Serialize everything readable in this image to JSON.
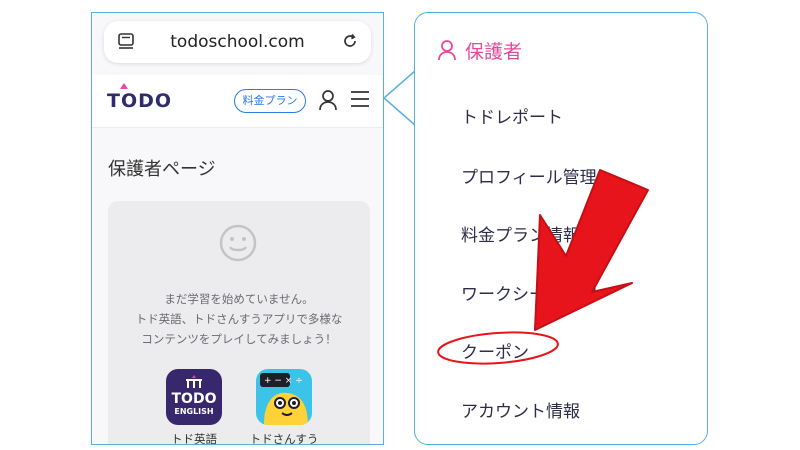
{
  "browser": {
    "url": "todoschool.com"
  },
  "header": {
    "logo": "TODO",
    "plan_button": "料金プラン"
  },
  "page": {
    "title": "保護者ページ",
    "empty_line1": "まだ学習を始めていません。",
    "empty_line2": "トド英語、トドさんすうアプリで多様な",
    "empty_line3": "コンテンツをプレイしてみましょう！"
  },
  "apps": [
    {
      "label": "トド英語",
      "icon_text": "TODO",
      "icon_subtext": "ENGLISH"
    },
    {
      "label": "トドさんすう"
    }
  ],
  "menu": {
    "heading": "保護者",
    "items": [
      "トドレポート",
      "プロフィール管理",
      "料金プラン情報",
      "ワークシート情報",
      "クーポン",
      "アカウント情報"
    ]
  },
  "colors": {
    "accent_pink": "#e64a9a",
    "accent_blue": "#2b7be0",
    "annotation_red": "#e8141c",
    "frame_blue": "#5aaee0"
  }
}
